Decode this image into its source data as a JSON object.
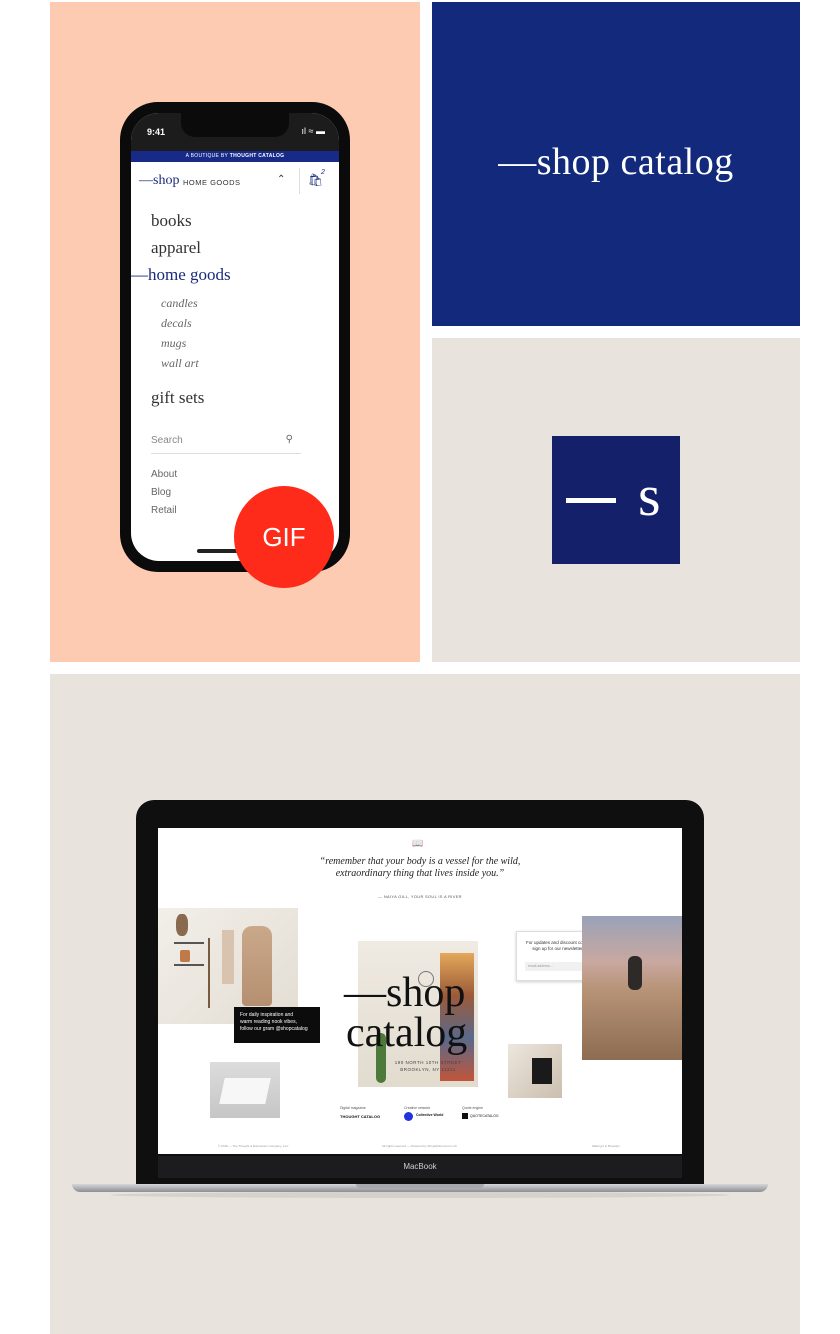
{
  "colors": {
    "peach": "#fdcbb2",
    "navy": "#132a7c",
    "beige": "#e8e4dd",
    "gif_red": "#fe2b1a"
  },
  "navy_panel": {
    "title": "—shop catalog"
  },
  "logo_square": {
    "dash": "—",
    "letter": "s"
  },
  "phone": {
    "status_time": "9:41",
    "status_icons": "ıl ≈ ▬",
    "banner_prefix": "A BOUTIQUE BY",
    "banner_brand": "THOUGHT CATALOG",
    "brand": "—shop",
    "section": "HOME GOODS",
    "chevron_icon": "chevron-up-icon",
    "cart_icon": "shopping-bag-icon",
    "cart_count": "2",
    "menu": [
      "books",
      "apparel",
      "—home goods",
      "gift sets"
    ],
    "submenu": [
      "candles",
      "decals",
      "mugs",
      "wall art"
    ],
    "search_placeholder": "Search",
    "search_icon": "search-icon",
    "links": [
      "About",
      "Blog",
      "Retail"
    ],
    "gif_badge": "GIF"
  },
  "laptop": {
    "brand_label": "MacBook",
    "screen": {
      "book_icon": "book-icon",
      "quote_line1": "“remember that your body is a vessel for the wild,",
      "quote_line2": "extraordinary thing that lives inside you.”",
      "attribution": "— NAIYA GILL, YOUR SOUL IS A RIVER",
      "instagram_text_1": "For daily inspiration and",
      "instagram_text_2": "warm reading nook vibes,",
      "instagram_text_3": "follow our gram @shopcatalog",
      "newsletter_line1": "For updates and discount codes",
      "newsletter_line2": "sign up for our newsletter.",
      "newsletter_placeholder": "email address...",
      "hero_line1": "—shop",
      "hero_line2": "catalog",
      "address_line1": "190 NORTH 10TH STREET",
      "address_line2": "BROOKLYN, NY 11211",
      "footer": {
        "digital_label": "Digital magazine",
        "digital_name": "THOUGHT CATALOG",
        "creative_label": "Creative network",
        "creative_name": "Collective World",
        "quote_label": "Quote engine",
        "quote_name": "QUOTECATALOG"
      },
      "bottom_left": "© 2018 — The Thought & Expression Company, LLC",
      "bottom_center": "All rights reserved — Powered by ShopifyNow.com's Lift",
      "bottom_right": "Making it in Brooklyn"
    }
  }
}
